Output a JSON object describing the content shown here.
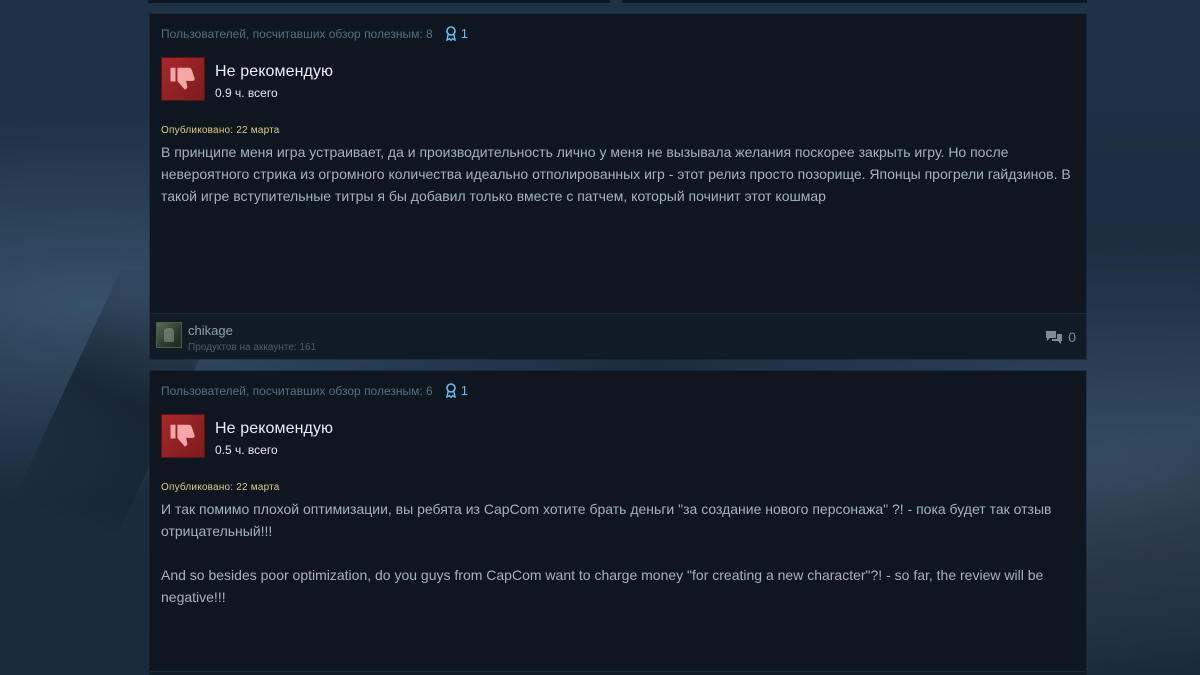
{
  "reviews": [
    {
      "helpful_text": "Пользователей, посчитавших обзор полезным: 8",
      "award_count": "1",
      "verdict": "Не рекомендую",
      "hours": "0.9 ч. всего",
      "posted": "Опубликовано: 22 марта",
      "paragraphs": [
        "В принципе меня игра устраивает, да и производительность лично у меня не вызывала желания поскорее закрыть игру. Но после невероятного стрика из огромного количества идеально отполированных игр - этот релиз просто позорище. Японцы прогрели гайдзинов. В такой игре вступительные титры я бы добавил только вместе с патчем, который починит этот кошмар"
      ],
      "author": "chikage",
      "products": "Продуктов на аккаунте: 161",
      "comments": "0"
    },
    {
      "helpful_text": "Пользователей, посчитавших обзор полезным: 6",
      "award_count": "1",
      "verdict": "Не рекомендую",
      "hours": "0.5 ч. всего",
      "posted": "Опубликовано: 22 марта",
      "paragraphs": [
        "И так помимо плохой оптимизации, вы ребята из CapCom хотите брать деньги \"за создание нового персонажа\" ?! - пока будет так отзыв отрицательный!!!",
        "And so besides poor optimization, do you guys from CapCom want to charge money \"for creating a new character\"?! - so far, the review will be negative!!!"
      ]
    }
  ],
  "colors": {
    "thumb_red": "#a8282a",
    "award_blue": "#66c0f4",
    "posted_gold": "#e0c98a",
    "panel_bg": "#0e1720"
  },
  "icons": {
    "thumb": "thumbs-down-icon",
    "award": "award-ribbon-icon",
    "comments": "comment-bubbles-icon"
  }
}
